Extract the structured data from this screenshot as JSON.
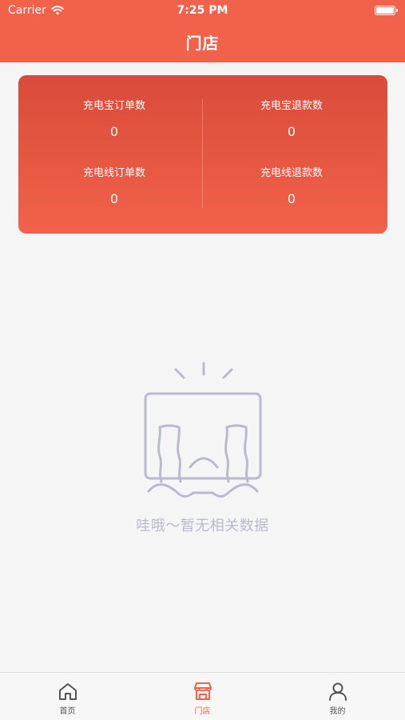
{
  "status_bar": {
    "carrier": "Carrier",
    "time": "7:25 PM"
  },
  "header": {
    "title": "门店"
  },
  "stats": [
    {
      "label": "充电宝订单数",
      "value": "0"
    },
    {
      "label": "充电宝退款数",
      "value": "0"
    },
    {
      "label": "充电线订单数",
      "value": "0"
    },
    {
      "label": "充电线退款数",
      "value": "0"
    }
  ],
  "empty": {
    "message": "哇哦～暂无相关数据"
  },
  "tabs": [
    {
      "label": "首页",
      "icon": "home-icon"
    },
    {
      "label": "门店",
      "icon": "store-icon",
      "active": true
    },
    {
      "label": "我的",
      "icon": "user-icon"
    }
  ],
  "colors": {
    "accent": "#f2624a",
    "accent_dark": "#d94b3a",
    "empty_gray": "#b9bbcc"
  }
}
